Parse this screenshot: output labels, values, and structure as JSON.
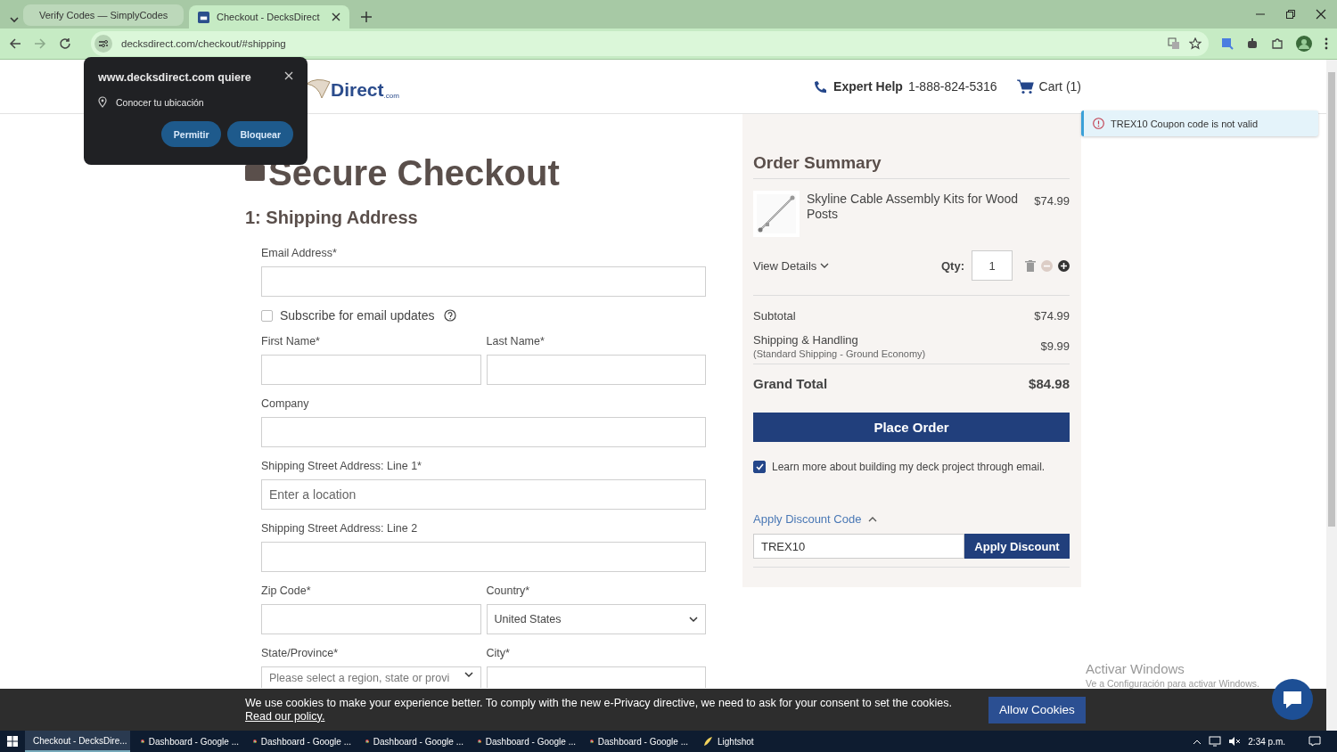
{
  "browser": {
    "tabs": [
      {
        "title": "Verify Codes — SimplyCodes",
        "selected": false
      },
      {
        "title": "Checkout - DecksDirect",
        "selected": true
      }
    ],
    "url": "decksdirect.com/checkout/#shipping"
  },
  "permission_popup": {
    "title": "www.decksdirect.com quiere",
    "permission": "Conocer tu ubicación",
    "buttons": [
      "Permitir",
      "Bloquear"
    ]
  },
  "header": {
    "logo_text": "Direct",
    "logo_sub": ".com",
    "help_label": "Expert Help",
    "phone": "1-888-824-5316",
    "cart": "Cart (1)"
  },
  "toast": "TREX10 Coupon code is not valid",
  "checkout": {
    "title": "Secure Checkout",
    "section": "1: Shipping Address",
    "rows": [
      [
        {
          "kind": "text",
          "label": "Email Address*"
        }
      ],
      [
        {
          "kind": "checkbox",
          "label": "Subscribe for email updates",
          "checked": false
        }
      ],
      [
        {
          "kind": "text",
          "label": "First Name*"
        },
        {
          "kind": "text",
          "label": "Last Name*"
        }
      ],
      [
        {
          "kind": "text",
          "label": "Company"
        }
      ],
      [
        {
          "kind": "text",
          "label": "Shipping Street Address: Line 1*",
          "placeholder": "Enter a location"
        }
      ],
      [
        {
          "kind": "text",
          "label": "Shipping Street Address: Line 2"
        }
      ],
      [
        {
          "kind": "text",
          "label": "Zip Code*"
        },
        {
          "kind": "select",
          "label": "Country*",
          "value": "United States"
        }
      ],
      [
        {
          "kind": "select",
          "label": "State/Province*",
          "placeholder": "Please select a region, state or provi"
        },
        {
          "kind": "text",
          "label": "City*"
        }
      ]
    ]
  },
  "summary": {
    "title": "Order Summary",
    "items": [
      {
        "name": "Skyline Cable Assembly Kits for Wood Posts",
        "price": "$74.99",
        "details": "View Details",
        "qty_label": "Qty:",
        "qty": "1"
      }
    ],
    "totals": [
      {
        "kind": "normal",
        "label": "Subtotal",
        "value": "$74.99"
      },
      {
        "kind": "normal",
        "label": "Shipping & Handling",
        "note": "(Standard Shipping - Ground Economy)",
        "value": "$9.99"
      },
      {
        "kind": "grand",
        "label": "Grand Total",
        "value": "$84.98"
      }
    ],
    "place_order": "Place Order",
    "newsletter": {
      "label": "Learn more about building my deck project through email.",
      "checked": true
    },
    "discount": {
      "toggle": "Apply Discount Code",
      "expanded": true,
      "value": "TREX10",
      "button": "Apply Discount"
    }
  },
  "cookie_banner": {
    "text": "We use cookies to make your experience better. To comply with the new e-Privacy directive, we need to ask for your consent to set the cookies.",
    "link": "Read our policy.",
    "button": "Allow Cookies"
  },
  "windows_notice": {
    "title": "Activar Windows",
    "text": "Ve a Configuración para activar Windows."
  },
  "taskbar": {
    "items": [
      {
        "label": "Checkout - DecksDire...",
        "kind": "chrome",
        "selected": true
      },
      {
        "label": "Dashboard - Google ...",
        "kind": "chrome",
        "selected": false
      },
      {
        "label": "Dashboard - Google ...",
        "kind": "chrome",
        "selected": false
      },
      {
        "label": "Dashboard - Google ...",
        "kind": "chrome",
        "selected": false
      },
      {
        "label": "Dashboard - Google ...",
        "kind": "chrome",
        "selected": false
      },
      {
        "label": "Dashboard - Google ...",
        "kind": "chrome",
        "selected": false
      },
      {
        "label": "Lightshot",
        "kind": "app",
        "selected": false
      }
    ],
    "time": "2:34 p.m."
  }
}
